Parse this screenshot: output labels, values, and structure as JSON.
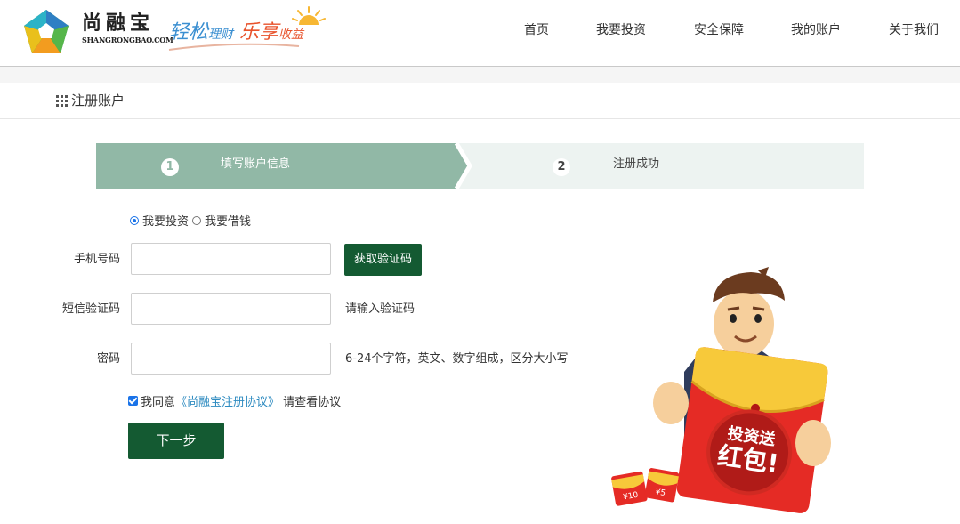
{
  "header": {
    "brand_cn": "尚融宝",
    "brand_en": "SHANGRONGBAO.COM",
    "slogan": {
      "part1": "轻松",
      "part2": "理财",
      "part3": "乐享",
      "part4": "收益"
    },
    "nav": [
      {
        "label": "首页",
        "active": true
      },
      {
        "label": "我要投资",
        "active": false
      },
      {
        "label": "安全保障",
        "active": false
      },
      {
        "label": "我的账户",
        "active": false
      },
      {
        "label": "关于我们",
        "active": false
      }
    ]
  },
  "section": {
    "title": "注册账户",
    "icon": "grid-icon"
  },
  "steps": [
    {
      "num": "1",
      "label": "填写账户信息",
      "active": true
    },
    {
      "num": "2",
      "label": "注册成功",
      "active": false
    }
  ],
  "form": {
    "user_types": [
      {
        "label": "我要投资",
        "checked": true
      },
      {
        "label": "我要借钱",
        "checked": false
      }
    ],
    "phone": {
      "label": "手机号码",
      "value": ""
    },
    "get_code_label": "获取验证码",
    "sms_code": {
      "label": "短信验证码",
      "value": "",
      "hint": "请输入验证码"
    },
    "password": {
      "label": "密码",
      "value": "",
      "hint": "6-24个字符，英文、数字组成，区分大小写"
    },
    "agree": {
      "checked": true,
      "prefix": "我同意",
      "link": "《尚融宝注册协议》",
      "suffix": " 请查看协议"
    },
    "next_label": "下一步"
  },
  "promo": {
    "envelope_line1": "投资送",
    "envelope_line2": "红包!",
    "coin1": "¥10",
    "coin2": "¥5"
  },
  "colors": {
    "accent": "#145a32",
    "step_active": "#91b8a6",
    "step_inactive": "#edf3f1",
    "nav_active": "#2e8bc0",
    "link": "#2e8bc0"
  }
}
